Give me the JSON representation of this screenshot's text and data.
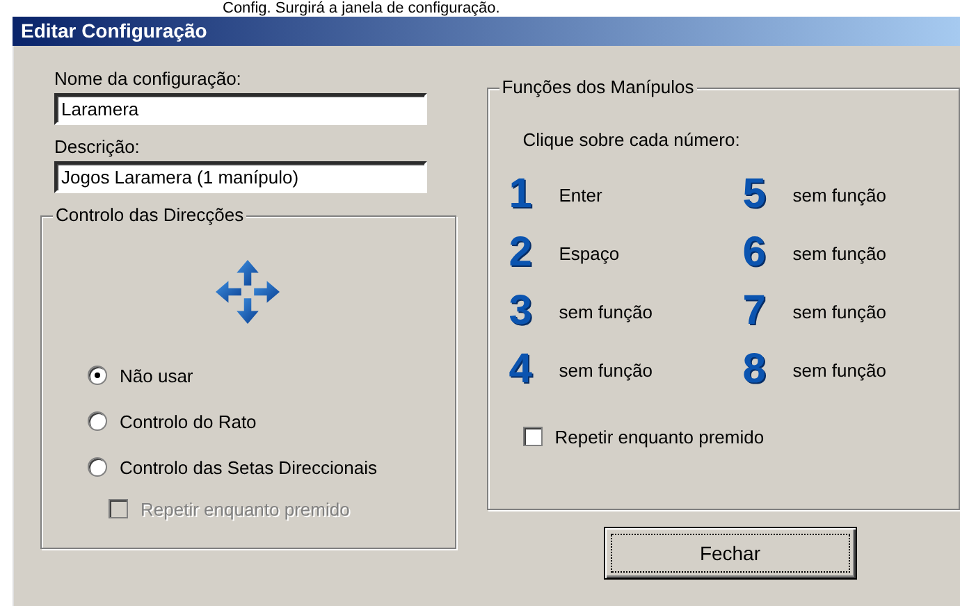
{
  "caption": "Config. Surgirá a janela de configuração.",
  "window": {
    "title": "Editar Configuração"
  },
  "name_field": {
    "label": "Nome da configuração:",
    "value": "Laramera"
  },
  "description_field": {
    "label": "Descrição:",
    "value": "Jogos Laramera (1 manípulo)"
  },
  "directions": {
    "title": "Controlo das Direcções",
    "options": [
      {
        "label": "Não usar",
        "selected": true
      },
      {
        "label": "Controlo do Rato",
        "selected": false
      },
      {
        "label": "Controlo das Setas Direccionais",
        "selected": false
      }
    ],
    "repeat": {
      "label": "Repetir enquanto premido",
      "checked": false,
      "disabled": true
    }
  },
  "buttons_panel": {
    "title": "Funções dos Manípulos",
    "hint": "Clique sobre cada número:",
    "functions": [
      {
        "number": "1",
        "label": "Enter"
      },
      {
        "number": "2",
        "label": "Espaço"
      },
      {
        "number": "3",
        "label": "sem função"
      },
      {
        "number": "4",
        "label": "sem função"
      },
      {
        "number": "5",
        "label": "sem função"
      },
      {
        "number": "6",
        "label": "sem função"
      },
      {
        "number": "7",
        "label": "sem função"
      },
      {
        "number": "8",
        "label": "sem função"
      }
    ],
    "repeat": {
      "label": "Repetir enquanto premido",
      "checked": false,
      "disabled": false
    }
  },
  "close_button": "Fechar"
}
